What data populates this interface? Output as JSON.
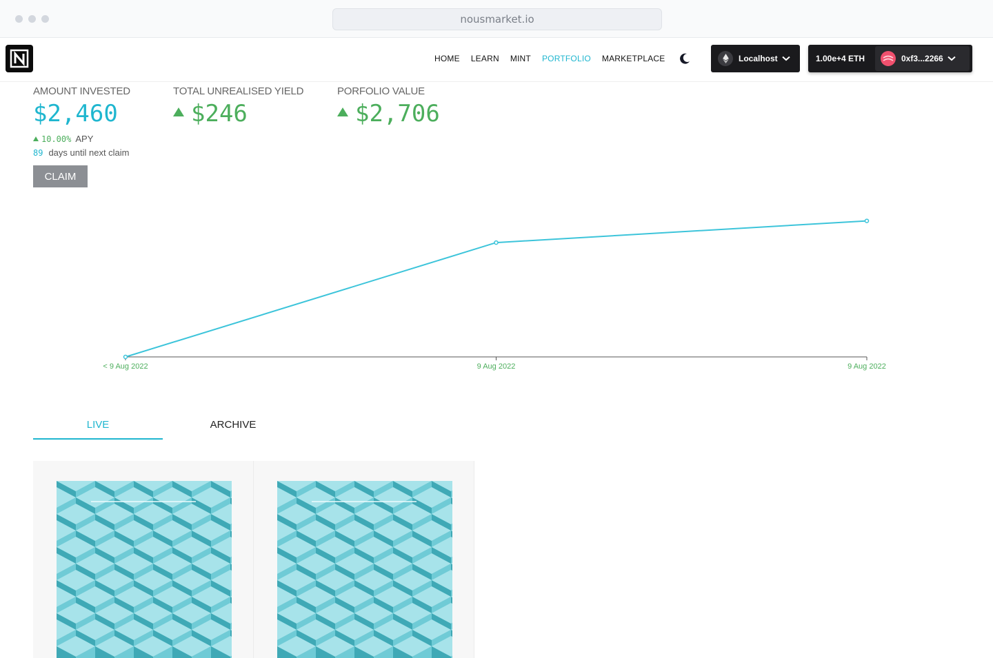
{
  "browser": {
    "url": "nousmarket.io"
  },
  "nav": {
    "links": [
      {
        "label": "HOME",
        "active": false
      },
      {
        "label": "LEARN",
        "active": false
      },
      {
        "label": "MINT",
        "active": false
      },
      {
        "label": "PORTFOLIO",
        "active": true
      },
      {
        "label": "MARKETPLACE",
        "active": false
      }
    ],
    "theme_icon": "moon-icon",
    "network": {
      "label": "Localhost",
      "icon": "ethereum-icon"
    },
    "wallet": {
      "balance": "1.00e+4 ETH",
      "address": "0xf3...2266"
    }
  },
  "stats": {
    "amount_invested": {
      "label": "AMOUNT INVESTED",
      "value": "$2,460"
    },
    "unrealised_yield": {
      "label": "TOTAL UNREALISED YIELD",
      "value": "$246"
    },
    "portfolio_value": {
      "label": "PORFOLIO VALUE",
      "value": "$2,706"
    },
    "apy": {
      "value": "10.00%",
      "label": "APY"
    },
    "claim": {
      "days": "89",
      "label": "days until next claim",
      "button": "CLAIM"
    }
  },
  "chart_data": {
    "type": "line",
    "x": [
      "< 9 Aug 2022",
      "9 Aug 2022",
      "9 Aug 2022"
    ],
    "series": [
      {
        "values": [
          0,
          0.79,
          0.94
        ]
      }
    ],
    "title": "",
    "xlabel": "",
    "ylabel": "",
    "grid": false,
    "colors": {
      "line": "#3cc4da",
      "axis_labels": "#4cae5c"
    }
  },
  "tabs": [
    {
      "label": "LIVE",
      "active": true
    },
    {
      "label": "ARCHIVE",
      "active": false
    }
  ],
  "cards": [
    {
      "image": "cube-grid-artwork"
    },
    {
      "image": "cube-grid-artwork"
    }
  ]
}
